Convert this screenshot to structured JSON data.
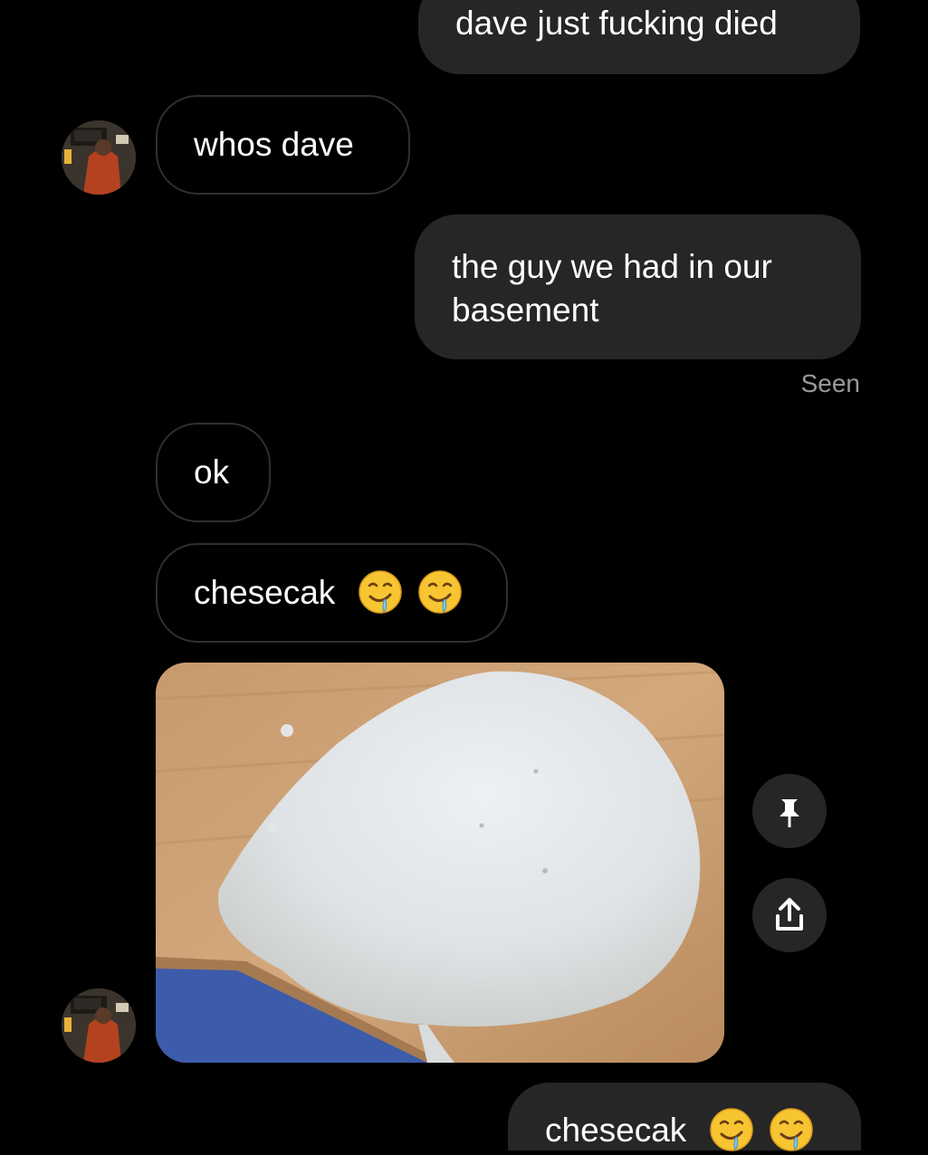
{
  "messages": {
    "m1": {
      "text": "dave just fucking died"
    },
    "m2": {
      "text": "whos dave"
    },
    "m3": {
      "line1": "the guy we had in our",
      "line2": "basement"
    },
    "m4": {
      "text": "ok"
    },
    "m5": {
      "text": "chesecak",
      "emojis": [
        "drooling-face",
        "drooling-face"
      ]
    },
    "m6": {
      "type": "photo",
      "subject": "cheesecake"
    },
    "m7": {
      "text": "chesecak",
      "emojis": [
        "drooling-face",
        "drooling-face"
      ]
    }
  },
  "status": {
    "seen": "Seen"
  },
  "actions": {
    "pin_icon": "pin-icon",
    "share_icon": "share-icon"
  },
  "colors": {
    "background": "#000000",
    "sent_bubble": "#262626",
    "received_border": "#2f2f2f",
    "text": "#ffffff",
    "muted": "#9a9a9a"
  }
}
